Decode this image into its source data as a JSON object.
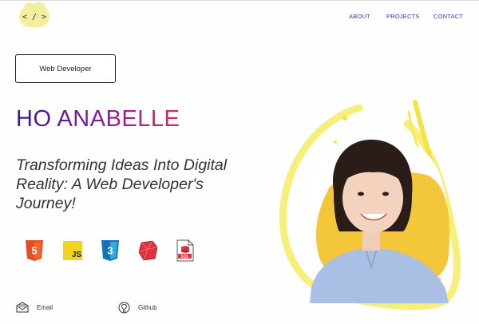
{
  "header": {
    "logo_text": "< / >",
    "nav": [
      {
        "label": "ABOUT"
      },
      {
        "label": "PROJECTS"
      },
      {
        "label": "CONTACT"
      }
    ]
  },
  "hero": {
    "role_label": "Web Developer",
    "name": "HO ANABELLE",
    "tagline": "Transforming Ideas Into Digital Reality: A Web Developer's Journey!"
  },
  "tech_icons": [
    {
      "icon": "html5-icon",
      "text": "5",
      "color": "#e44d26"
    },
    {
      "icon": "javascript-icon",
      "text": "JS",
      "color": "#f0d41d"
    },
    {
      "icon": "css3-icon",
      "text": "3",
      "color": "#1572b6"
    },
    {
      "icon": "ruby-icon",
      "text": "",
      "color": "#e0313f"
    },
    {
      "icon": "sql-file-icon",
      "text": "SQL",
      "color": "#e0313f"
    }
  ],
  "contacts": [
    {
      "icon": "email-icon",
      "label": "Email"
    },
    {
      "icon": "github-icon",
      "label": "Github"
    }
  ],
  "colors": {
    "accent_blue": "#3b2fb8",
    "name_gradient_start": "#3a1a8a",
    "name_gradient_end": "#d42a6a",
    "logo_bg": "#f2efa1",
    "portrait_blob": "#f4c63a"
  }
}
